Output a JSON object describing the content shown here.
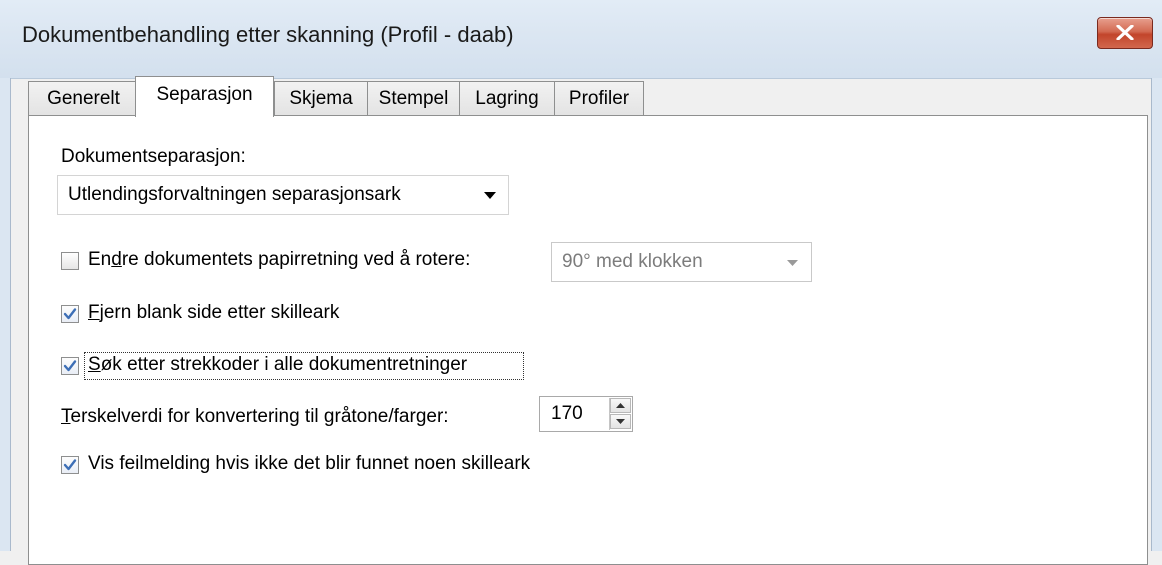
{
  "window": {
    "title": "Dokumentbehandling etter skanning (Profil - daab)",
    "close_icon": "close-icon"
  },
  "tabs": [
    {
      "label": "Generelt",
      "active": false
    },
    {
      "label": "Separasjon",
      "active": true
    },
    {
      "label": "Skjema",
      "active": false
    },
    {
      "label": "Stempel",
      "active": false
    },
    {
      "label": "Lagring",
      "active": false
    },
    {
      "label": "Profiler",
      "active": false
    }
  ],
  "separation": {
    "label": "Dokumentseparasjon:",
    "selected": "Utlendingsforvaltningen separasjonsark"
  },
  "rotate": {
    "label_pre": "En",
    "label_key": "d",
    "label_post": "re dokumentets papirretning ved å rotere:",
    "checked": false,
    "selected": "90° med klokken"
  },
  "remove_blank": {
    "label_key": "F",
    "label_post": "jern blank side etter skilleark",
    "checked": true
  },
  "barcodes": {
    "label_key": "S",
    "label_post": "øk etter strekkoder i alle dokumentretninger",
    "checked": true
  },
  "threshold": {
    "label_key": "T",
    "label_post": "erskelverdi for konvertering til gråtone/farger:",
    "value": "170"
  },
  "error_message": {
    "label": "Vis feilmelding hvis ikke det blir funnet noen skilleark",
    "checked": true
  },
  "colors": {
    "accent": "#c2452b",
    "check": "#3d6fb6"
  }
}
